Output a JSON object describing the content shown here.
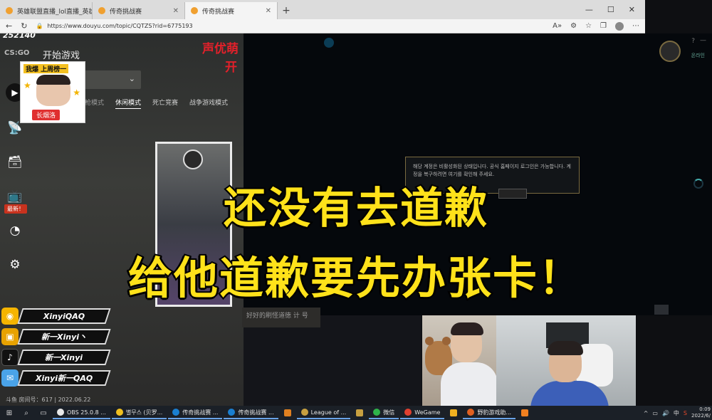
{
  "browser": {
    "tabs": [
      {
        "label": "英雄联盟直播_lol直播_英雄联盟",
        "active": false
      },
      {
        "label": "传奇挑战赛",
        "active": false
      },
      {
        "label": "传奇挑战赛",
        "active": true
      }
    ],
    "new_tab": "+",
    "window_controls": {
      "minimize": "—",
      "maximize": "☐",
      "close": "✕"
    },
    "url": "https://www.douyu.com/topic/CQTZS?rid=6775193",
    "reader_icon": "A»"
  },
  "lobby": {
    "stream_id": "252140",
    "logo_text": "CS:GO",
    "start_game": "开始游戏",
    "mode_tabs": [
      "练枪模式",
      "休闲模式",
      "死亡竞赛",
      "战争游戏模式"
    ],
    "selected_mode": "休闲模式",
    "new_badge": "最新！",
    "footer": "斗鱼 房间号：617 | 2022.06.22"
  },
  "thumb": {
    "title": "我爆 上周榜一",
    "name": "长烟洛"
  },
  "headline": {
    "line1": "声优萌",
    "line2": "开"
  },
  "client": {
    "help": "?",
    "minimize": "—",
    "online_label": "온라인",
    "notice_text": "해당 계정은 비활성화된 상태입니다. 공식 홈페이지 로그인은 가능합니다. 계정을 복구하려면 여기를 확인해 주세요."
  },
  "caption": {
    "line1": "还没有去道歉",
    "line2": "给他道歉要先办张卡！"
  },
  "socials": [
    {
      "platform": "weibo",
      "icon": "◉",
      "label": "XinyiQAQ"
    },
    {
      "platform": "bilibili",
      "icon": "▣",
      "label": "新一Xinyi丶"
    },
    {
      "platform": "douyin",
      "icon": "♪",
      "label": "新一Xinyi"
    },
    {
      "platform": "qq",
      "icon": "✉",
      "label": "Xinyi新一QAQ"
    }
  ],
  "subtitle_strip": "好好的刷怪道徳 计 号",
  "taskbar": {
    "apps": [
      {
        "label": "OBS 25.0.8 ...",
        "color": "#e8e8e8"
      },
      {
        "label": "별무스 (贝罗...",
        "color": "#f0c020"
      },
      {
        "label": "传奇挑战赛 ...",
        "color": "#1a7fd0"
      },
      {
        "label": "传奇挑战赛 ...",
        "color": "#1a7fd0"
      },
      {
        "label": "",
        "color": "#e08020"
      },
      {
        "label": "League of ...",
        "color": "#c8a040"
      },
      {
        "label": "",
        "color": "#c8a040"
      },
      {
        "label": "微信",
        "color": "#2fb34a"
      },
      {
        "label": "WeGame",
        "color": "#e04030"
      },
      {
        "label": "",
        "color": "#f0b020"
      },
      {
        "label": "野豹游戏助...",
        "color": "#e06020"
      },
      {
        "label": "",
        "color": "#f08020"
      }
    ],
    "tray_text": "中",
    "time": "0:09",
    "date": "2022/6/"
  },
  "colors": {
    "caption": "#ffe21a",
    "headline": "#e4202a",
    "badge_red": "#c8321e"
  }
}
